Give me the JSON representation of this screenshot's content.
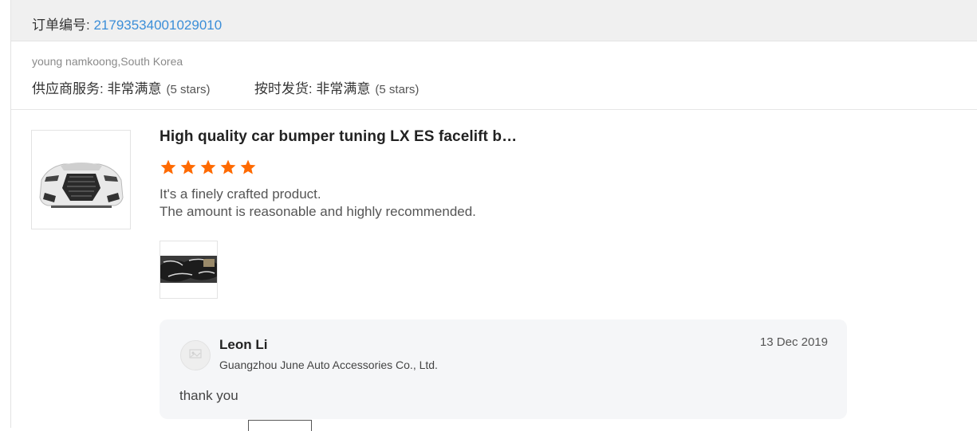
{
  "order": {
    "label": "订单编号: ",
    "number": "21793534001029010"
  },
  "buyer": {
    "name_country": "young namkoong,South Korea"
  },
  "ratings": [
    {
      "label": "供应商服务: ",
      "value": "非常满意",
      "stars_text": "(5 stars)"
    },
    {
      "label": "按时发货: ",
      "value": "非常满意",
      "stars_text": "(5 stars)"
    }
  ],
  "product": {
    "title": "High quality car bumper tuning LX ES facelift b…",
    "star_rating": 5,
    "star_color": "#ff6a00",
    "review_line1": "It's a finely crafted product.",
    "review_line2": "The amount is reasonable and highly recommended."
  },
  "reply": {
    "seller_name": "Leon Li",
    "company": "Guangzhou June Auto Accessories Co., Ltd.",
    "date": "13 Dec 2019",
    "text": "thank you"
  },
  "colors": {
    "link": "#3b8ed8",
    "header_bg": "#f0f0f0",
    "reply_bg": "#f5f6f8"
  }
}
